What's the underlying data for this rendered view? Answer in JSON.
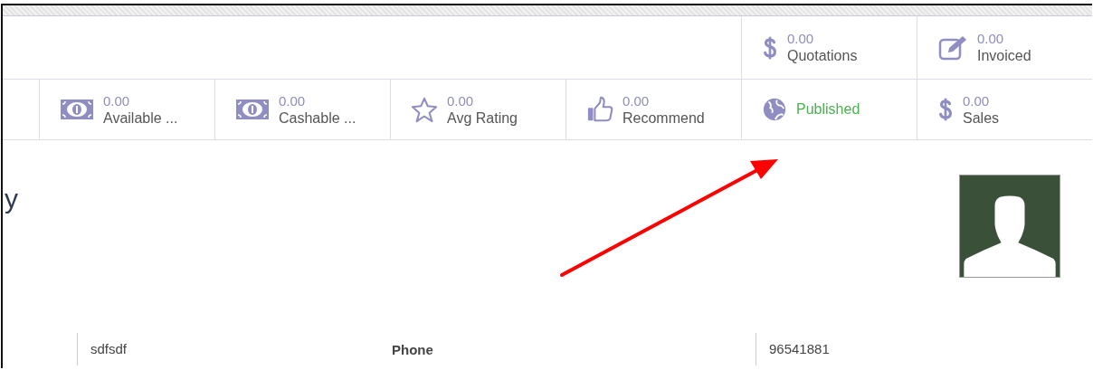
{
  "button_box": {
    "buttons": [
      {
        "kind": "stat",
        "value": "0.00",
        "label": "Quotations"
      },
      {
        "kind": "stat",
        "value": "0.00",
        "label": "Invoiced"
      },
      {
        "kind": "stat",
        "value": "0.00",
        "label": "Available ..."
      },
      {
        "kind": "stat",
        "value": "0.00",
        "label": "Cashable ..."
      },
      {
        "kind": "stat",
        "value": "0.00",
        "label": "Avg Rating"
      },
      {
        "kind": "stat",
        "value": "0.00",
        "label": "Recommend"
      },
      {
        "kind": "status",
        "label": "Published"
      },
      {
        "kind": "stat",
        "value": "0.00",
        "label": "Sales"
      }
    ]
  },
  "title": "y",
  "fields": [
    {
      "value": "sdfsdf"
    },
    {
      "label": "Phone",
      "value": "96541881"
    }
  ]
}
